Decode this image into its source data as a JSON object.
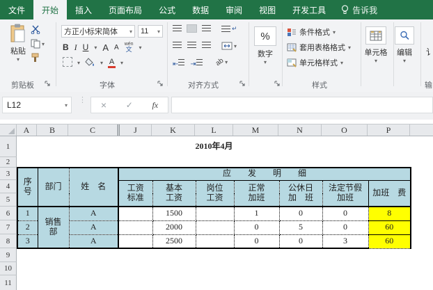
{
  "app": {
    "tabs": [
      {
        "label": "文件",
        "active": false
      },
      {
        "label": "开始",
        "active": true
      },
      {
        "label": "插入",
        "active": false
      },
      {
        "label": "页面布局",
        "active": false
      },
      {
        "label": "公式",
        "active": false
      },
      {
        "label": "数据",
        "active": false
      },
      {
        "label": "审阅",
        "active": false
      },
      {
        "label": "视图",
        "active": false
      },
      {
        "label": "开发工具",
        "active": false
      }
    ],
    "tell_me": "告诉我"
  },
  "icons": {
    "dropdown": "▾",
    "cancel": "×",
    "enter": "✓",
    "fx": "fx",
    "percent": "%",
    "bold": "B",
    "italic": "I",
    "underline": "U",
    "increase_font": "A",
    "decrease_font": "A",
    "phonetic_top": "wén",
    "phonetic_bottom": "文",
    "font_color_a": "A",
    "orientation": "ab"
  },
  "ribbon": {
    "clipboard": {
      "paste": "粘贴",
      "label": "剪贴板"
    },
    "font": {
      "font_name": "方正小标宋简体",
      "font_size": "11",
      "label": "字体"
    },
    "alignment": {
      "label": "对齐方式"
    },
    "number": {
      "label": "数字"
    },
    "styles": {
      "conditional": "条件格式",
      "format_table": "套用表格格式",
      "cell_styles": "单元格样式",
      "label": "样式"
    },
    "cells": {
      "label": "单元格"
    },
    "editing": {
      "label": "编辑"
    },
    "partial": {
      "button_fragment": "讠",
      "label_fragment": "输"
    }
  },
  "formula_bar": {
    "name_box": "L12",
    "formula": ""
  },
  "sheet": {
    "col_headers": [
      "A",
      "B",
      "C",
      "J",
      "K",
      "L",
      "M",
      "N",
      "O",
      "P"
    ],
    "row_headers": [
      "1",
      "2",
      "3",
      "4",
      "5",
      "6",
      "7",
      "8",
      "9",
      "10",
      "11"
    ],
    "title": "2010年4月",
    "table": {
      "header": {
        "seq": "序\n号",
        "dept": "部门",
        "name": "姓　名",
        "detail": "应　　发　　明　　细",
        "salary_std": "工资\n标准",
        "base_salary": "基本\n工资",
        "post_salary": "岗位\n工资",
        "normal_ot": "正常\n加班",
        "weekend_ot": "公休日\n加　班",
        "holiday_ot": "法定节假\n加班",
        "ot_fee": "加班　费"
      },
      "dept_value": "销售\n部",
      "rows": [
        {
          "seq": "1",
          "name": "A",
          "salary_std": "",
          "base": "1500",
          "post": "",
          "normal": "1",
          "weekend": "0",
          "holiday": "0",
          "fee": "8"
        },
        {
          "seq": "2",
          "name": "A",
          "salary_std": "",
          "base": "2000",
          "post": "",
          "normal": "0",
          "weekend": "5",
          "holiday": "0",
          "fee": "60"
        },
        {
          "seq": "3",
          "name": "A",
          "salary_std": "",
          "base": "2500",
          "post": "",
          "normal": "0",
          "weekend": "0",
          "holiday": "3",
          "fee": "60"
        }
      ]
    }
  },
  "colors": {
    "excel_green": "#217346",
    "header_blue": "#b7d9e2",
    "highlight_yellow": "#ffff00"
  }
}
